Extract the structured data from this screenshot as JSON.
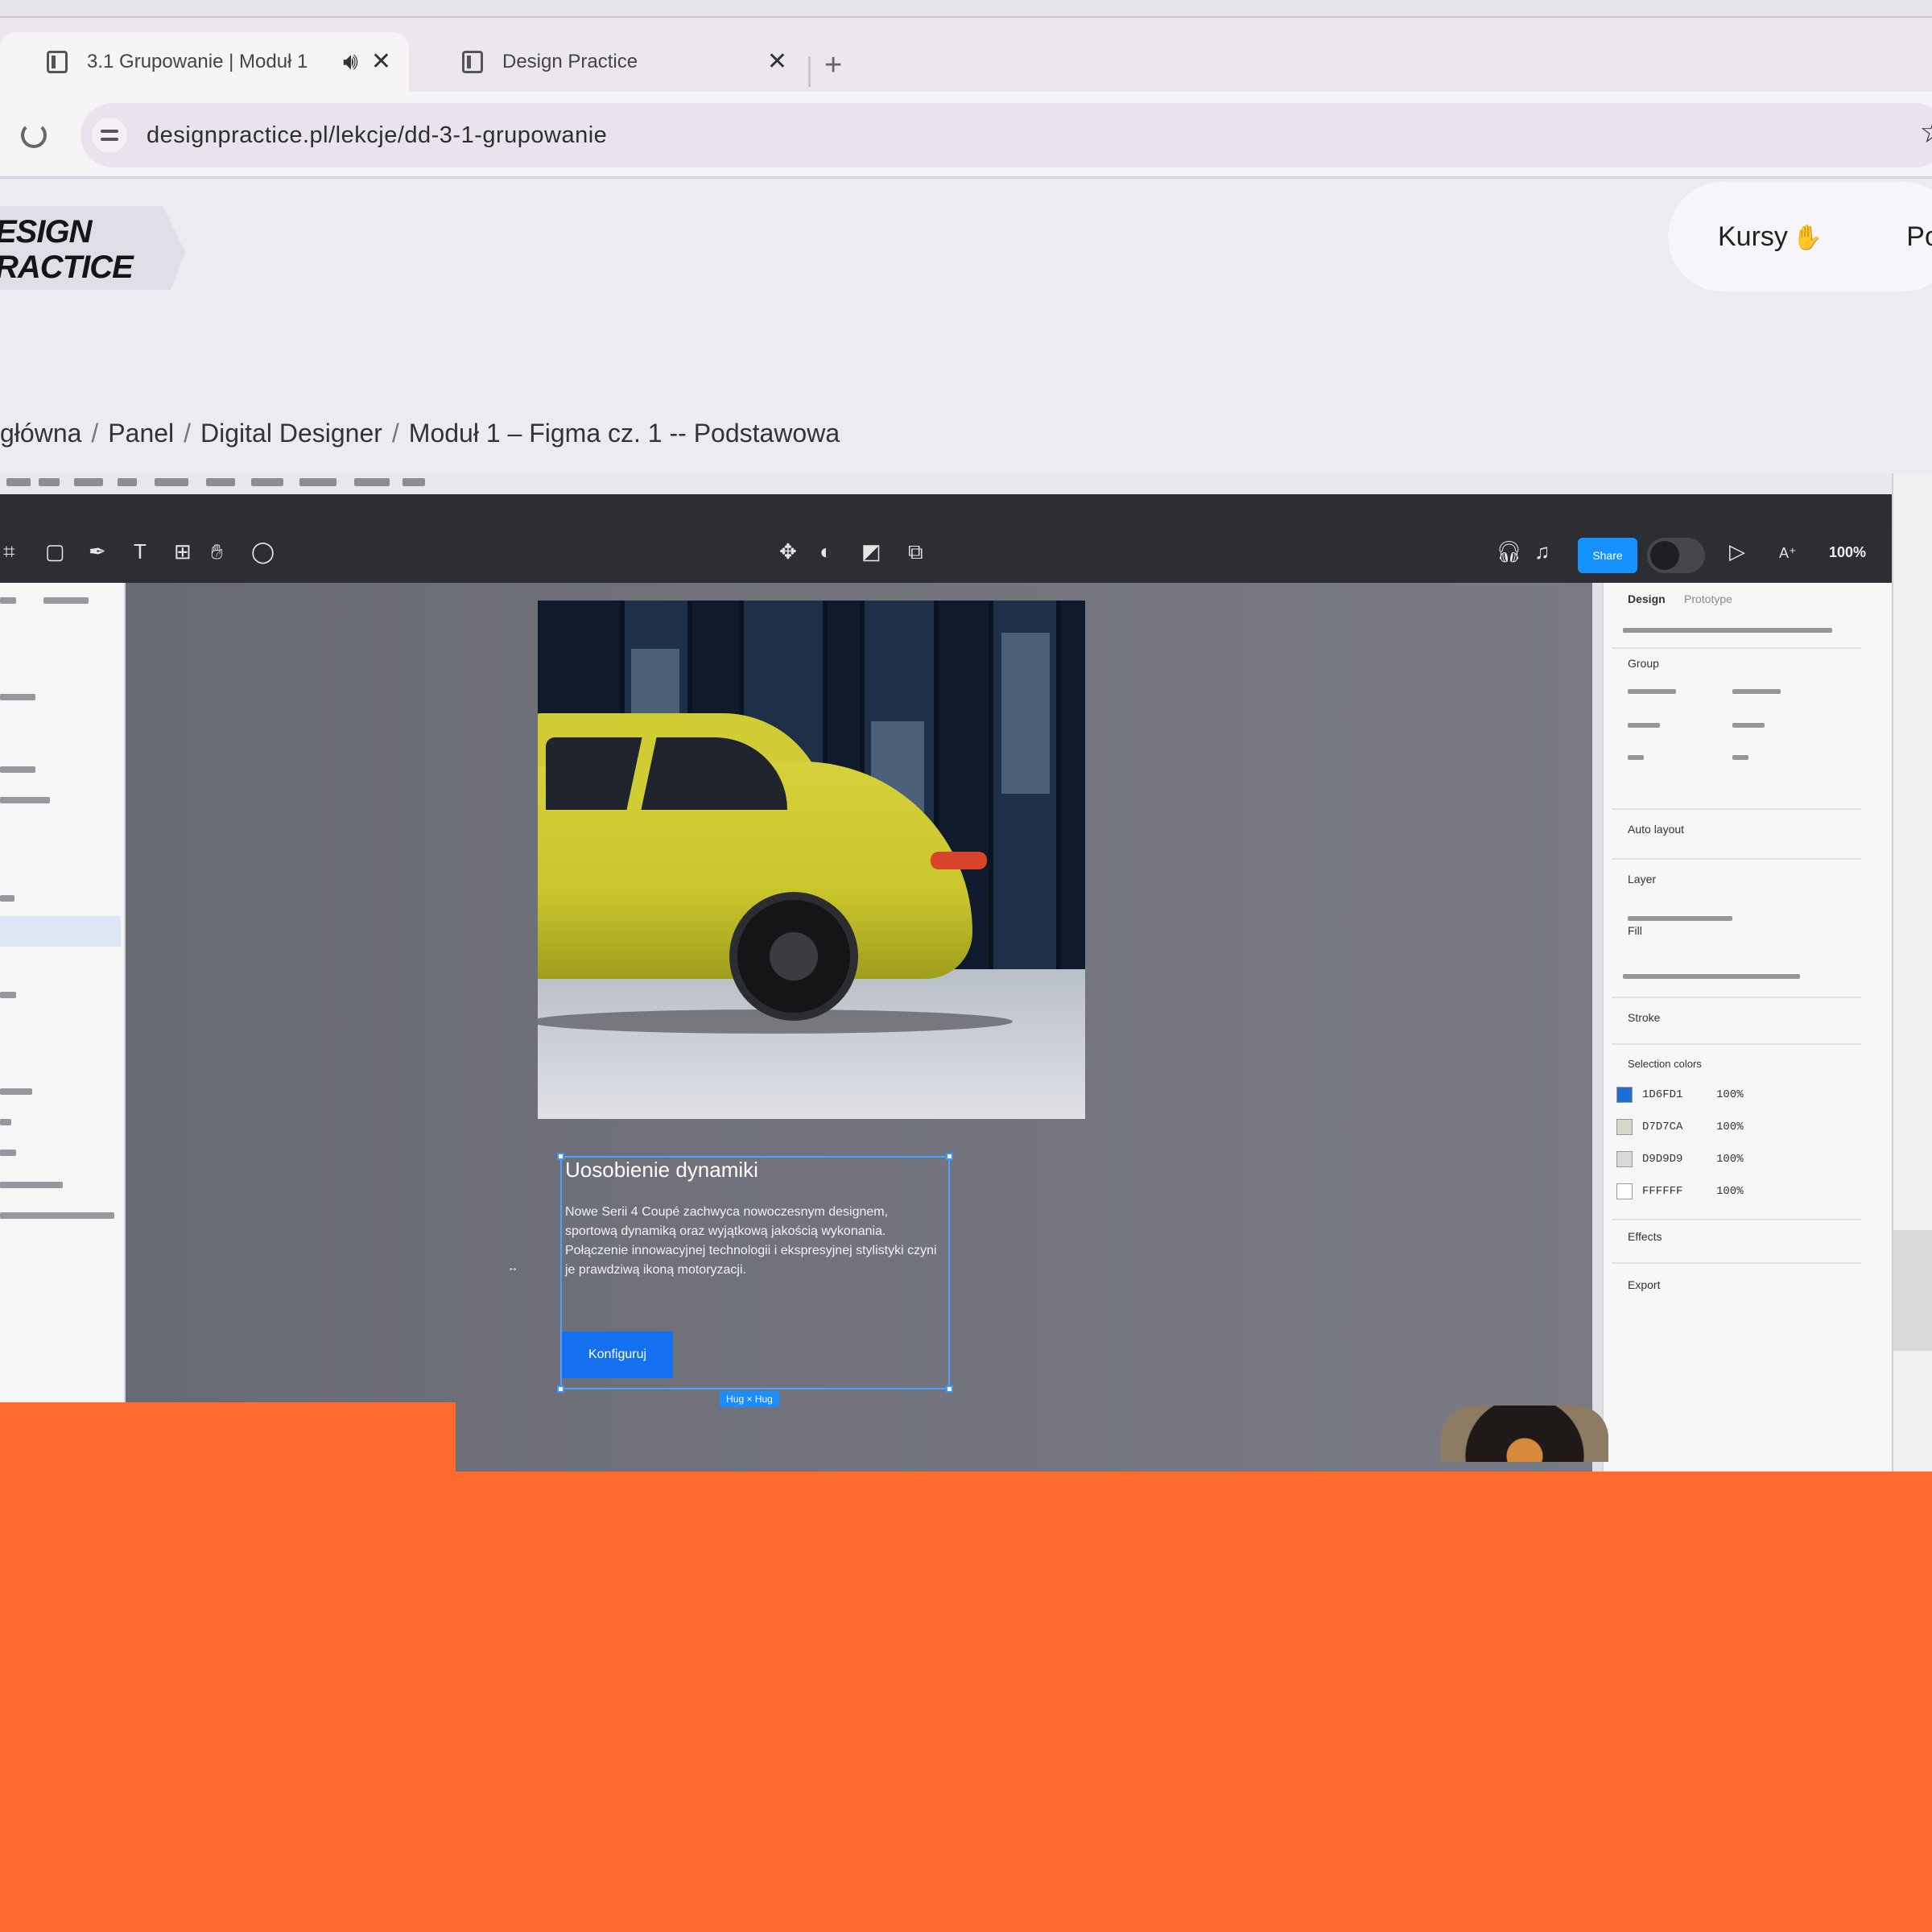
{
  "browser": {
    "tabs": [
      {
        "label": "3.1 Grupowanie | Moduł 1",
        "active": true
      },
      {
        "label": "Design Practice",
        "active": false
      }
    ],
    "new_tab_label": "+",
    "tab_audio_icon": "speaker-icon",
    "tab_close_glyph": "✕",
    "url": "designpractice.pl/lekcje/dd-3-1-grupowanie",
    "bookmark_glyph": "☆"
  },
  "site": {
    "logo_line1": "ESIGN",
    "logo_line2": "RACTICE",
    "nav": {
      "kursy": "Kursy",
      "kursy_emoji": "✋",
      "next": "Po"
    },
    "breadcrumb": [
      "główna",
      "Panel",
      "Digital Designer",
      "Moduł 1 – Figma cz. 1 -- Podstawowa"
    ],
    "breadcrumb_sep": "/"
  },
  "figma": {
    "zoom": "100%",
    "share_label": "Share",
    "card": {
      "title": "Uosobienie dynamiki",
      "body": "Nowe Serii 4 Coupé zachwyca nowoczesnym designem, sportową dynamiką oraz wyjątkową jakością wykonania. Połączenie innowacyjnej technologii i ekspresyjnej stylistyki czyni je prawdziwą ikoną motoryzacji.",
      "button": "Konfiguruj"
    },
    "size_badge": "Hug × Hug",
    "properties": {
      "tabs": [
        "Design",
        "Prototype"
      ],
      "sections": [
        "Group",
        "Auto layout",
        "Layer",
        "Fill",
        "Stroke",
        "Selection colors",
        "Effects",
        "Export"
      ],
      "selection_colors": [
        {
          "hex": "1D6FD1",
          "opacity": "100%",
          "color": "#1d6fd1"
        },
        {
          "hex": "D7D7CA",
          "opacity": "100%",
          "color": "#d7d7ca"
        },
        {
          "hex": "D9D9D9",
          "opacity": "100%",
          "color": "#d9d9d9"
        },
        {
          "hex": "FFFFFF",
          "opacity": "100%",
          "color": "#ffffff"
        }
      ]
    }
  },
  "colors": {
    "accent": "#1470ef",
    "overlay": "#ff6b2c"
  }
}
